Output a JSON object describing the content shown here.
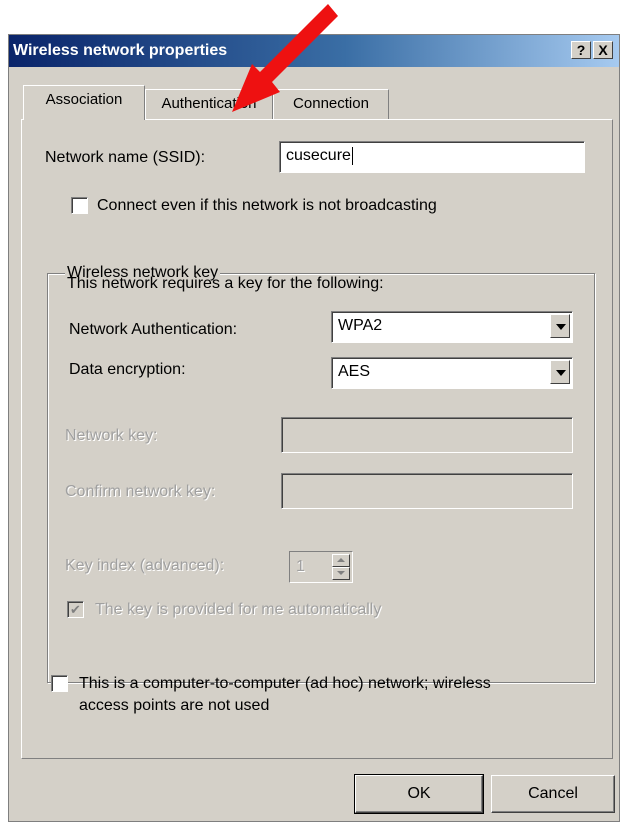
{
  "window": {
    "title": "Wireless network properties",
    "help_button": "?",
    "close_button": "X"
  },
  "tabs": [
    {
      "label": "Association",
      "active": true
    },
    {
      "label": "Authentication",
      "active": false
    },
    {
      "label": "Connection",
      "active": false
    }
  ],
  "association": {
    "ssid_label": "Network name (SSID):",
    "ssid_value": "cusecure",
    "broadcast_checkbox": {
      "label": "Connect even if this network is not broadcasting",
      "checked": false
    },
    "key_group": {
      "title": "Wireless network key",
      "intro": "This network requires a key for the following:",
      "auth_label": "Network Authentication:",
      "auth_value": "WPA2",
      "encryption_label": "Data encryption:",
      "encryption_value": "AES",
      "network_key_label": "Network key:",
      "network_key_value": "",
      "confirm_key_label": "Confirm network key:",
      "confirm_key_value": "",
      "key_index_label": "Key index (advanced):",
      "key_index_value": "1",
      "auto_key_checkbox": {
        "label": "The key is provided for me automatically",
        "checked": true
      }
    },
    "adhoc_checkbox": {
      "label_line1": "This is a computer-to-computer (ad hoc) network; wireless",
      "label_line2": "access points are not used",
      "checked": false
    }
  },
  "buttons": {
    "ok": "OK",
    "cancel": "Cancel"
  },
  "colors": {
    "annotation_arrow": "#ee1111",
    "title_bar": "#0a246a",
    "dialog_face": "#d4d0c8"
  }
}
